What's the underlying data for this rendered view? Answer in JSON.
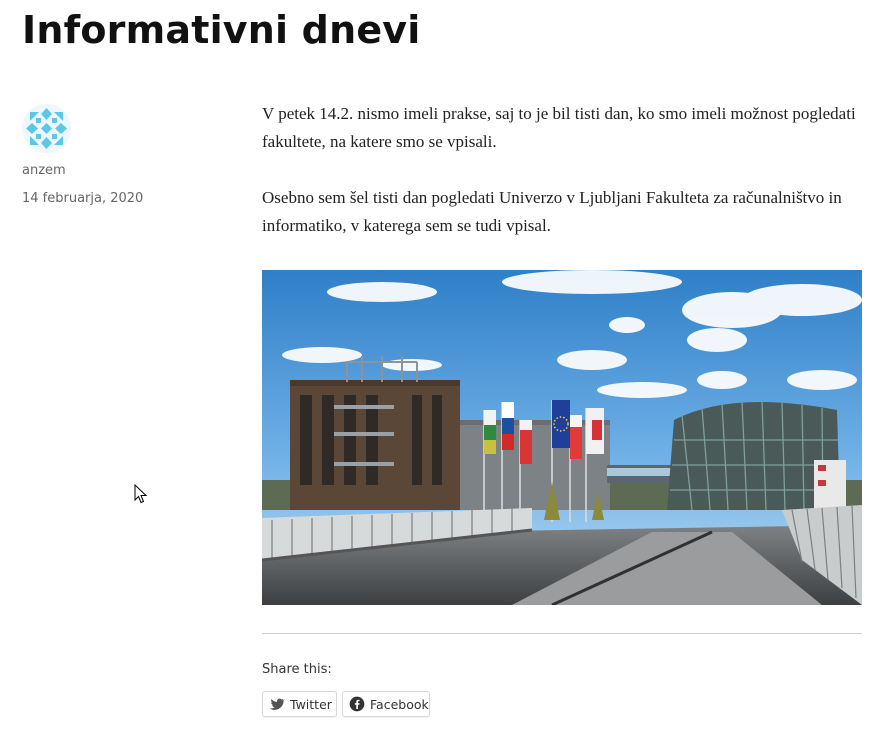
{
  "post": {
    "title": "Informativni dnevi",
    "author": "anzem",
    "date": "14 februarja, 2020",
    "paragraphs": [
      "V petek 14.2. nismo imeli prakse, saj to je bil tisti dan, ko smo imeli možnost pogledati fakultete, na katere smo se vpisali.",
      "Osebno sem šel tisti dan pogledati Univerzo v Ljubljani Fakulteta za računalništvo in informatiko, v katerega sem se tudi vpisal."
    ]
  },
  "share": {
    "label": "Share this:",
    "buttons": [
      {
        "label": "Twitter",
        "icon": "twitter-icon"
      },
      {
        "label": "Facebook",
        "icon": "facebook-icon"
      }
    ]
  },
  "colors": {
    "twitter": "#555555",
    "facebook": "#333333",
    "avatar": "#5bc8e8"
  }
}
